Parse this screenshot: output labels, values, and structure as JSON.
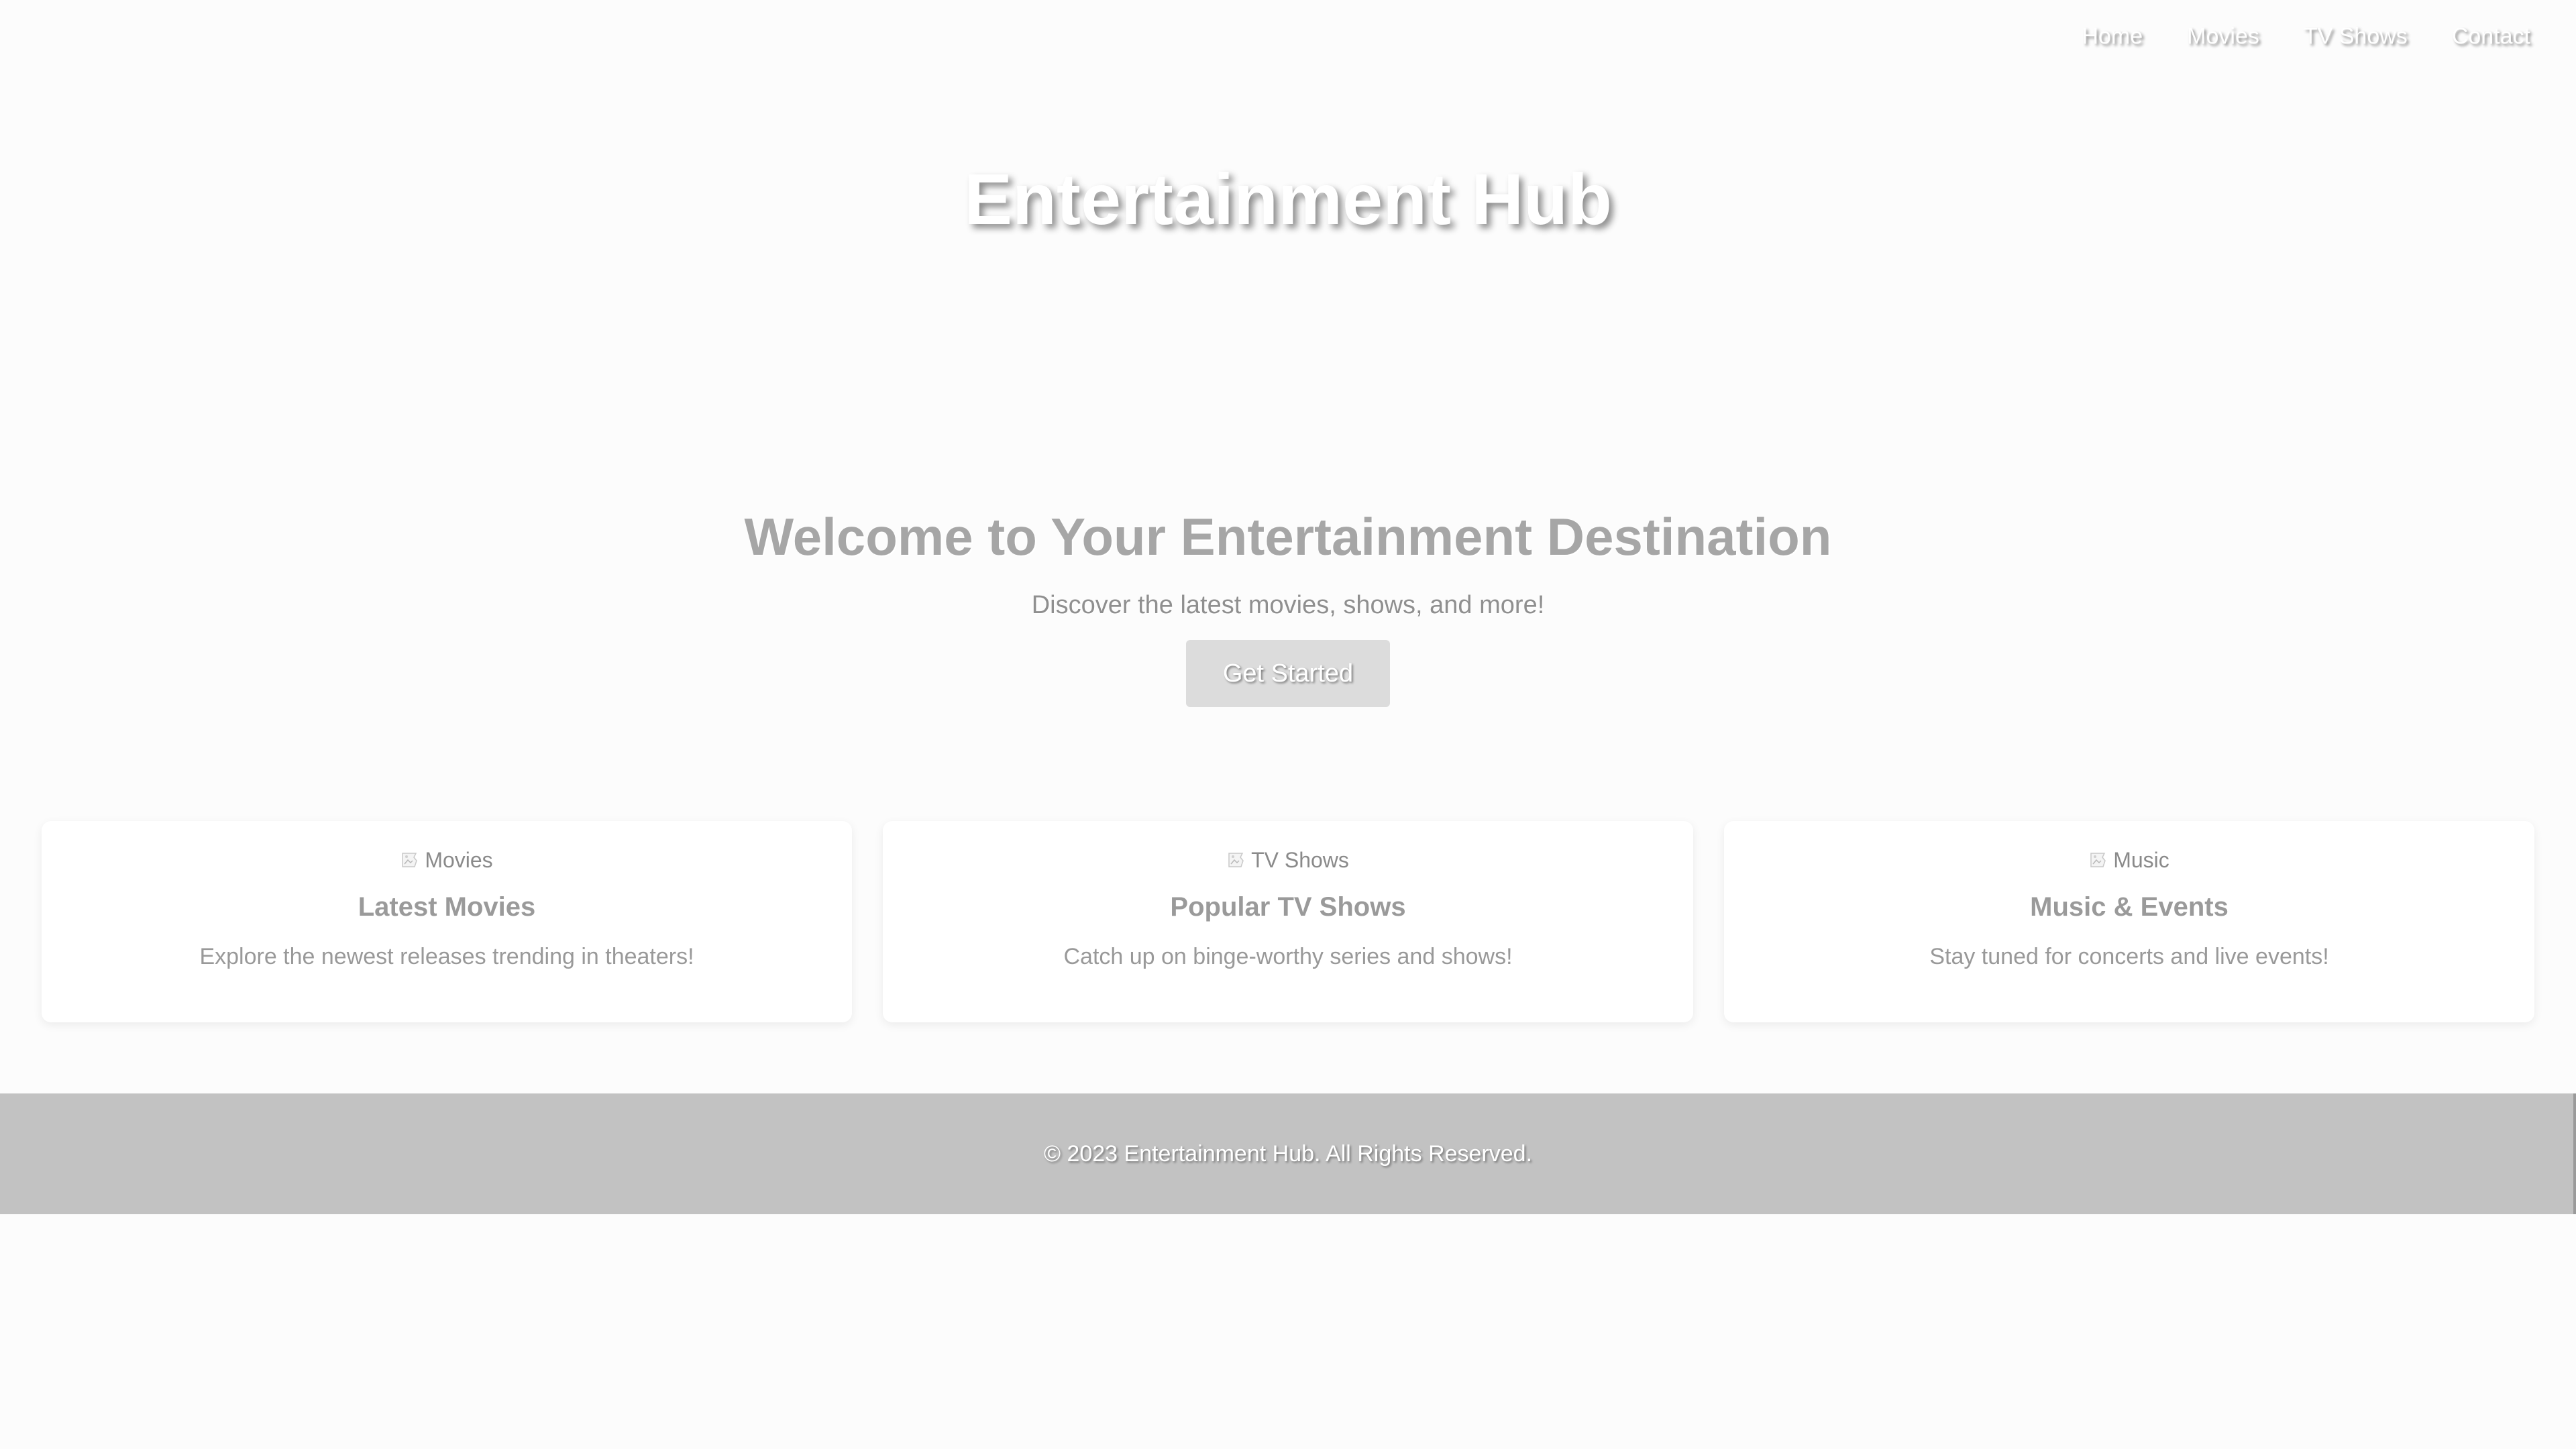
{
  "nav": {
    "items": [
      "Home",
      "Movies",
      "TV Shows",
      "Contact"
    ]
  },
  "hero": {
    "title": "Entertainment Hub"
  },
  "welcome": {
    "heading": "Welcome to Your Entertainment Destination",
    "subtitle": "Discover the latest movies, shows, and more!",
    "button_label": "Get Started"
  },
  "cards": [
    {
      "image_alt": "Movies",
      "image_icon": "broken-image-icon",
      "title": "Latest Movies",
      "description": "Explore the newest releases trending in theaters!"
    },
    {
      "image_alt": "TV Shows",
      "image_icon": "broken-image-icon",
      "title": "Popular TV Shows",
      "description": "Catch up on binge-worthy series and shows!"
    },
    {
      "image_alt": "Music",
      "image_icon": "broken-image-icon",
      "title": "Music & Events",
      "description": "Stay tuned for concerts and live events!"
    }
  ],
  "footer": {
    "text": "© 2023 Entertainment Hub. All Rights Reserved."
  },
  "colors": {
    "page_background": "#fcfcfc",
    "footer_background": "#c2c2c2",
    "button_background": "#dcdcdc",
    "heading_text": "#a6a6a6"
  }
}
